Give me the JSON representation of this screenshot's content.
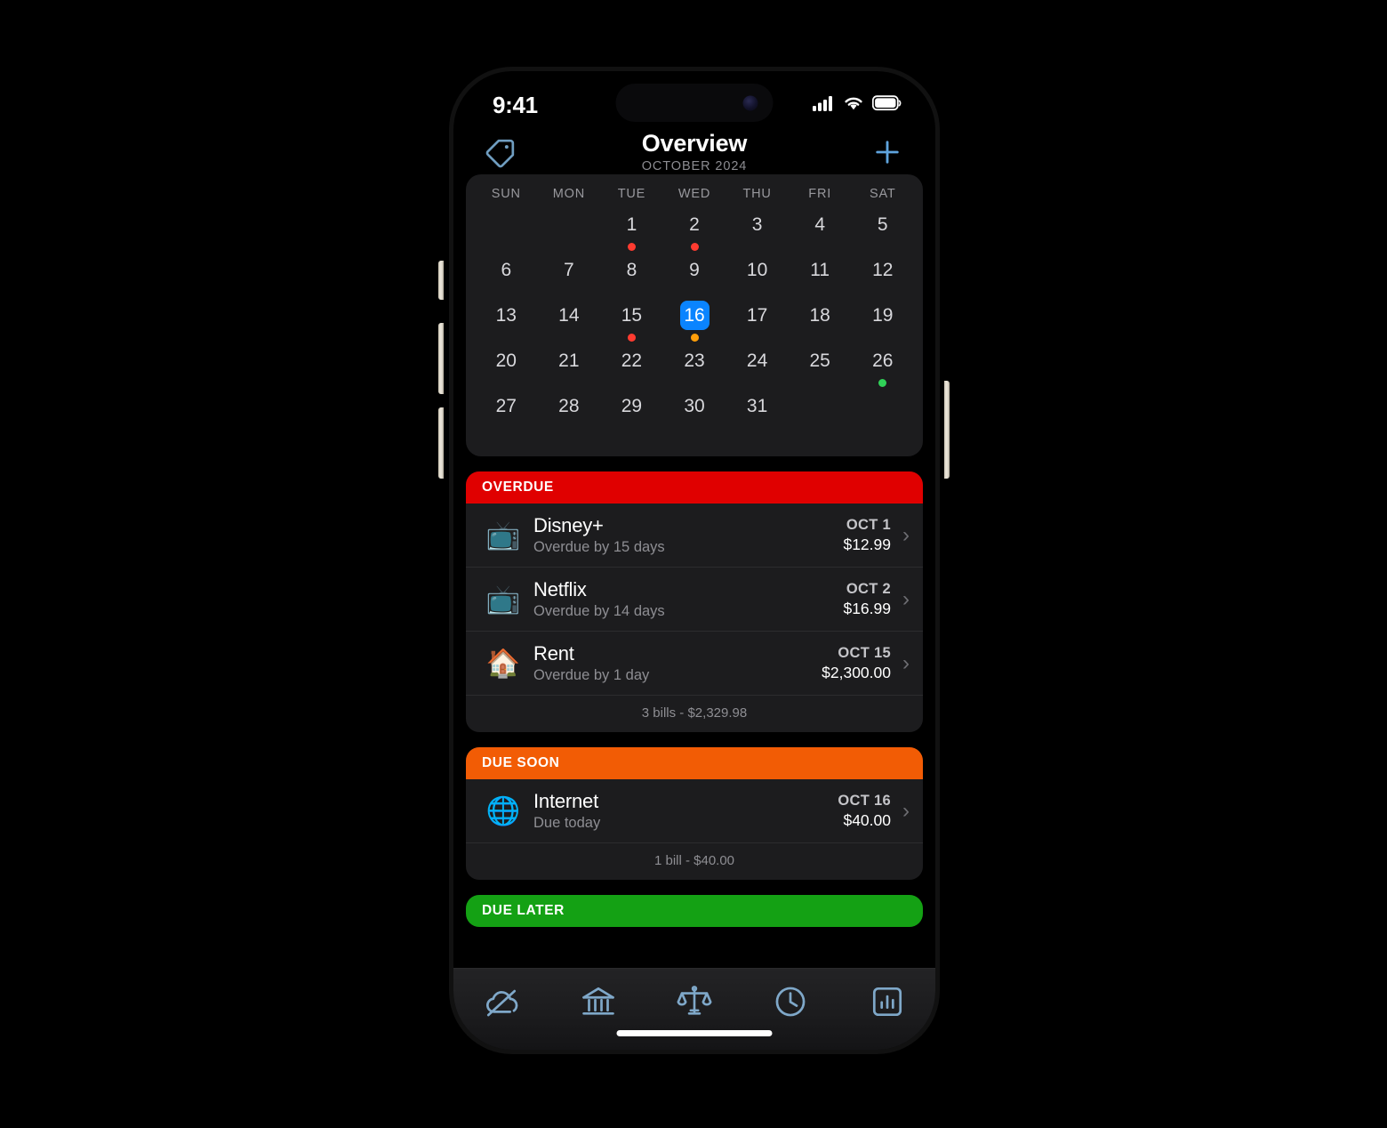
{
  "status_bar": {
    "time": "9:41",
    "icons": [
      "cellular-signal-icon",
      "wifi-icon",
      "battery-icon"
    ]
  },
  "nav": {
    "tag_icon": "tag-icon",
    "title": "Overview",
    "subtitle": "OCTOBER 2024",
    "add_icon": "plus-icon"
  },
  "calendar": {
    "weekdays": [
      "SUN",
      "MON",
      "TUE",
      "WED",
      "THU",
      "FRI",
      "SAT"
    ],
    "selected_day": "16",
    "weeks": [
      [
        {
          "num": "",
          "dot": ""
        },
        {
          "num": "",
          "dot": ""
        },
        {
          "num": "1",
          "dot": "red"
        },
        {
          "num": "2",
          "dot": "red"
        },
        {
          "num": "3",
          "dot": ""
        },
        {
          "num": "4",
          "dot": ""
        },
        {
          "num": "5",
          "dot": ""
        }
      ],
      [
        {
          "num": "6",
          "dot": ""
        },
        {
          "num": "7",
          "dot": ""
        },
        {
          "num": "8",
          "dot": ""
        },
        {
          "num": "9",
          "dot": ""
        },
        {
          "num": "10",
          "dot": ""
        },
        {
          "num": "11",
          "dot": ""
        },
        {
          "num": "12",
          "dot": ""
        }
      ],
      [
        {
          "num": "13",
          "dot": ""
        },
        {
          "num": "14",
          "dot": ""
        },
        {
          "num": "15",
          "dot": "red"
        },
        {
          "num": "16",
          "dot": "orange",
          "today": true
        },
        {
          "num": "17",
          "dot": ""
        },
        {
          "num": "18",
          "dot": ""
        },
        {
          "num": "19",
          "dot": ""
        }
      ],
      [
        {
          "num": "20",
          "dot": ""
        },
        {
          "num": "21",
          "dot": ""
        },
        {
          "num": "22",
          "dot": ""
        },
        {
          "num": "23",
          "dot": ""
        },
        {
          "num": "24",
          "dot": ""
        },
        {
          "num": "25",
          "dot": ""
        },
        {
          "num": "26",
          "dot": "green"
        }
      ],
      [
        {
          "num": "27",
          "dot": ""
        },
        {
          "num": "28",
          "dot": ""
        },
        {
          "num": "29",
          "dot": ""
        },
        {
          "num": "30",
          "dot": ""
        },
        {
          "num": "31",
          "dot": ""
        },
        {
          "num": "",
          "dot": ""
        },
        {
          "num": "",
          "dot": ""
        }
      ]
    ],
    "dot_colors": {
      "red": "#ff3b30",
      "orange": "#ff9f0a",
      "green": "#30d158",
      "today_highlight": "#0a84ff"
    }
  },
  "sections": [
    {
      "title": "OVERDUE",
      "accent": "#e00000",
      "bills": [
        {
          "emoji": "📺",
          "icon_name": "television-icon",
          "name": "Disney+",
          "sub": "Overdue by 15 days",
          "date": "OCT 1",
          "amount": "$12.99"
        },
        {
          "emoji": "📺",
          "icon_name": "television-icon",
          "name": "Netflix",
          "sub": "Overdue by 14 days",
          "date": "OCT 2",
          "amount": "$16.99"
        },
        {
          "emoji": "🏠",
          "icon_name": "house-icon",
          "name": "Rent",
          "sub": "Overdue by 1 day",
          "date": "OCT 15",
          "amount": "$2,300.00"
        }
      ],
      "footer": "3 bills - $2,329.98"
    },
    {
      "title": "DUE SOON",
      "accent": "#f25c05",
      "bills": [
        {
          "emoji": "🌐",
          "icon_name": "globe-icon",
          "name": "Internet",
          "sub": "Due today",
          "date": "OCT 16",
          "amount": "$40.00"
        }
      ],
      "footer": "1 bill - $40.00"
    },
    {
      "title": "DUE LATER",
      "accent": "#14a114",
      "bills": [],
      "footer": ""
    }
  ],
  "tab_bar": {
    "items": [
      {
        "icon": "cloud-slash-icon",
        "label": ""
      },
      {
        "icon": "bank-icon",
        "label": ""
      },
      {
        "icon": "scales-icon",
        "label": ""
      },
      {
        "icon": "clock-icon",
        "label": ""
      },
      {
        "icon": "chart-icon",
        "label": ""
      }
    ],
    "tint": "#7fa8c9"
  }
}
